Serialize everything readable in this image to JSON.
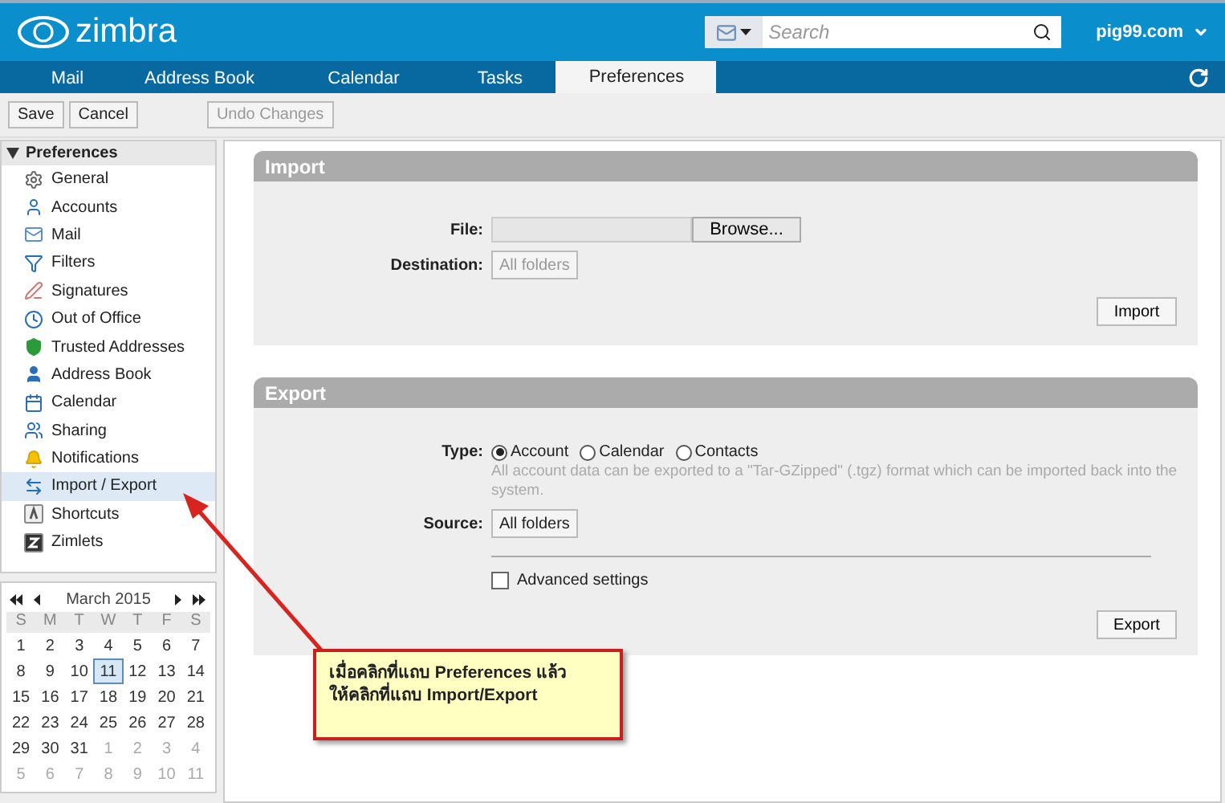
{
  "header": {
    "logo": "zimbra",
    "search": {
      "placeholder": "Search"
    },
    "account": "pig99.com"
  },
  "tabs": [
    {
      "label": "Mail",
      "selected": false
    },
    {
      "label": "Address Book",
      "selected": false
    },
    {
      "label": "Calendar",
      "selected": false
    },
    {
      "label": "Tasks",
      "selected": false
    },
    {
      "label": "Preferences",
      "selected": true
    }
  ],
  "toolbar": [
    {
      "label": "Save",
      "disabled": false
    },
    {
      "label": "Cancel",
      "disabled": false
    },
    {
      "label": "Undo Changes",
      "disabled": true
    }
  ],
  "sidebar": {
    "title": "Preferences",
    "expanded": true,
    "items": [
      {
        "label": "General",
        "selected": false
      },
      {
        "label": "Accounts",
        "selected": false
      },
      {
        "label": "Mail",
        "selected": false
      },
      {
        "label": "Filters",
        "selected": false
      },
      {
        "label": "Signatures",
        "selected": false
      },
      {
        "label": "Out of Office",
        "selected": false
      },
      {
        "label": "Trusted Addresses",
        "selected": false
      },
      {
        "label": "Address Book",
        "selected": false
      },
      {
        "label": "Calendar",
        "selected": false
      },
      {
        "label": "Sharing",
        "selected": false
      },
      {
        "label": "Notifications",
        "selected": false
      },
      {
        "label": "Import / Export",
        "selected": true
      },
      {
        "label": "Shortcuts",
        "selected": false
      },
      {
        "label": "Zimlets",
        "selected": false
      }
    ]
  },
  "calendar": {
    "month": "March 2015",
    "weekdays": [
      "S",
      "M",
      "T",
      "W",
      "T",
      "F",
      "S"
    ],
    "weeks": [
      [
        {
          "day": "1",
          "selected": false,
          "other_month": false
        },
        {
          "day": "2",
          "selected": false,
          "other_month": false
        },
        {
          "day": "3",
          "selected": false,
          "other_month": false
        },
        {
          "day": "4",
          "selected": false,
          "other_month": false
        },
        {
          "day": "5",
          "selected": false,
          "other_month": false
        },
        {
          "day": "6",
          "selected": false,
          "other_month": false
        },
        {
          "day": "7",
          "selected": false,
          "other_month": false
        }
      ],
      [
        {
          "day": "8",
          "selected": false,
          "other_month": false
        },
        {
          "day": "9",
          "selected": false,
          "other_month": false
        },
        {
          "day": "10",
          "selected": false,
          "other_month": false
        },
        {
          "day": "11",
          "selected": true,
          "other_month": false
        },
        {
          "day": "12",
          "selected": false,
          "other_month": false
        },
        {
          "day": "13",
          "selected": false,
          "other_month": false
        },
        {
          "day": "14",
          "selected": false,
          "other_month": false
        }
      ],
      [
        {
          "day": "15",
          "selected": false,
          "other_month": false
        },
        {
          "day": "16",
          "selected": false,
          "other_month": false
        },
        {
          "day": "17",
          "selected": false,
          "other_month": false
        },
        {
          "day": "18",
          "selected": false,
          "other_month": false
        },
        {
          "day": "19",
          "selected": false,
          "other_month": false
        },
        {
          "day": "20",
          "selected": false,
          "other_month": false
        },
        {
          "day": "21",
          "selected": false,
          "other_month": false
        }
      ],
      [
        {
          "day": "22",
          "selected": false,
          "other_month": false
        },
        {
          "day": "23",
          "selected": false,
          "other_month": false
        },
        {
          "day": "24",
          "selected": false,
          "other_month": false
        },
        {
          "day": "25",
          "selected": false,
          "other_month": false
        },
        {
          "day": "26",
          "selected": false,
          "other_month": false
        },
        {
          "day": "27",
          "selected": false,
          "other_month": false
        },
        {
          "day": "28",
          "selected": false,
          "other_month": false
        }
      ],
      [
        {
          "day": "29",
          "selected": false,
          "other_month": false
        },
        {
          "day": "30",
          "selected": false,
          "other_month": false
        },
        {
          "day": "31",
          "selected": false,
          "other_month": false
        },
        {
          "day": "1",
          "selected": false,
          "other_month": true
        },
        {
          "day": "2",
          "selected": false,
          "other_month": true
        },
        {
          "day": "3",
          "selected": false,
          "other_month": true
        },
        {
          "day": "4",
          "selected": false,
          "other_month": true
        }
      ],
      [
        {
          "day": "5",
          "selected": false,
          "other_month": true
        },
        {
          "day": "6",
          "selected": false,
          "other_month": true
        },
        {
          "day": "7",
          "selected": false,
          "other_month": true
        },
        {
          "day": "8",
          "selected": false,
          "other_month": true
        },
        {
          "day": "9",
          "selected": false,
          "other_month": true
        },
        {
          "day": "10",
          "selected": false,
          "other_month": true
        },
        {
          "day": "11",
          "selected": false,
          "other_month": true
        }
      ]
    ]
  },
  "import": {
    "title": "Import",
    "file_label": "File:",
    "browse": "Browse...",
    "destination_label": "Destination:",
    "destination": "All folders",
    "button": "Import"
  },
  "export": {
    "title": "Export",
    "type_label": "Type:",
    "types": [
      {
        "label": "Account",
        "selected": true
      },
      {
        "label": "Calendar",
        "selected": false
      },
      {
        "label": "Contacts",
        "selected": false
      }
    ],
    "hint": "All account data can be exported to a \"Tar-GZipped\" (.tgz) format which can be imported back into the system.",
    "source_label": "Source:",
    "source": "All folders",
    "advanced": {
      "label": "Advanced settings",
      "checked": false
    },
    "button": "Export"
  },
  "callout": {
    "lines": [
      "เมื่อคลิกที่แถบ Preferences แล้ว",
      "ให้คลิกที่แถบ Import/Export"
    ]
  }
}
